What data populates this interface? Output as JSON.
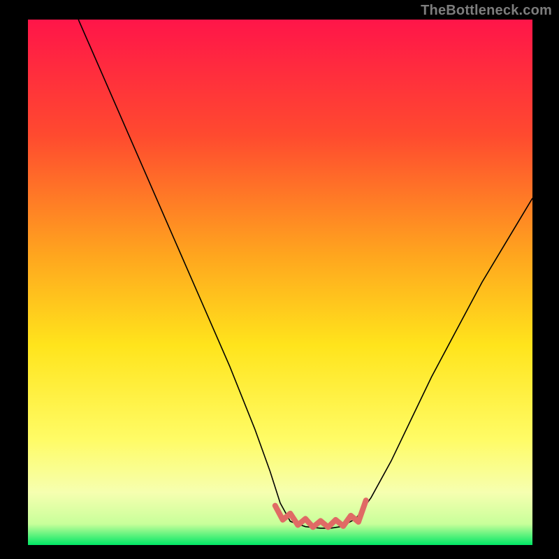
{
  "watermark": {
    "text": "TheBottleneck.com"
  },
  "chart_data": {
    "type": "line",
    "title": "",
    "xlabel": "",
    "ylabel": "",
    "xlim": [
      0,
      100
    ],
    "ylim": [
      0,
      100
    ],
    "grid": false,
    "legend": false,
    "background_gradient": {
      "stops": [
        {
          "offset": 0.0,
          "color": "#ff1549"
        },
        {
          "offset": 0.22,
          "color": "#ff4a2f"
        },
        {
          "offset": 0.45,
          "color": "#ffa61e"
        },
        {
          "offset": 0.62,
          "color": "#ffe41c"
        },
        {
          "offset": 0.8,
          "color": "#fffc66"
        },
        {
          "offset": 0.9,
          "color": "#f6ffb0"
        },
        {
          "offset": 0.96,
          "color": "#c8ff9a"
        },
        {
          "offset": 1.0,
          "color": "#00e765"
        }
      ]
    },
    "series": [
      {
        "name": "bottleneck-curve",
        "color": "#000000",
        "width": 1.6,
        "x": [
          10,
          15,
          20,
          25,
          30,
          35,
          40,
          45,
          48,
          50,
          52,
          55,
          58,
          60,
          62,
          65,
          68,
          72,
          76,
          80,
          85,
          90,
          95,
          100
        ],
        "y": [
          100,
          89,
          78,
          67,
          56,
          45,
          34,
          22,
          14,
          8,
          4.5,
          3.5,
          3.2,
          3.2,
          3.5,
          5,
          9,
          16,
          24,
          32,
          41,
          50,
          58,
          66
        ]
      }
    ],
    "annotations": [
      {
        "name": "optimal-zone-marker",
        "type": "wavy-path",
        "color": "#e06a65",
        "width": 8,
        "x": [
          49,
          50.5,
          52,
          53.5,
          55,
          56.5,
          58,
          59.5,
          61,
          62.5,
          64,
          65.5,
          67
        ],
        "y": [
          7.5,
          4.8,
          6.0,
          3.8,
          5.0,
          3.4,
          4.6,
          3.4,
          4.8,
          3.6,
          5.6,
          4.4,
          8.5
        ]
      }
    ]
  }
}
